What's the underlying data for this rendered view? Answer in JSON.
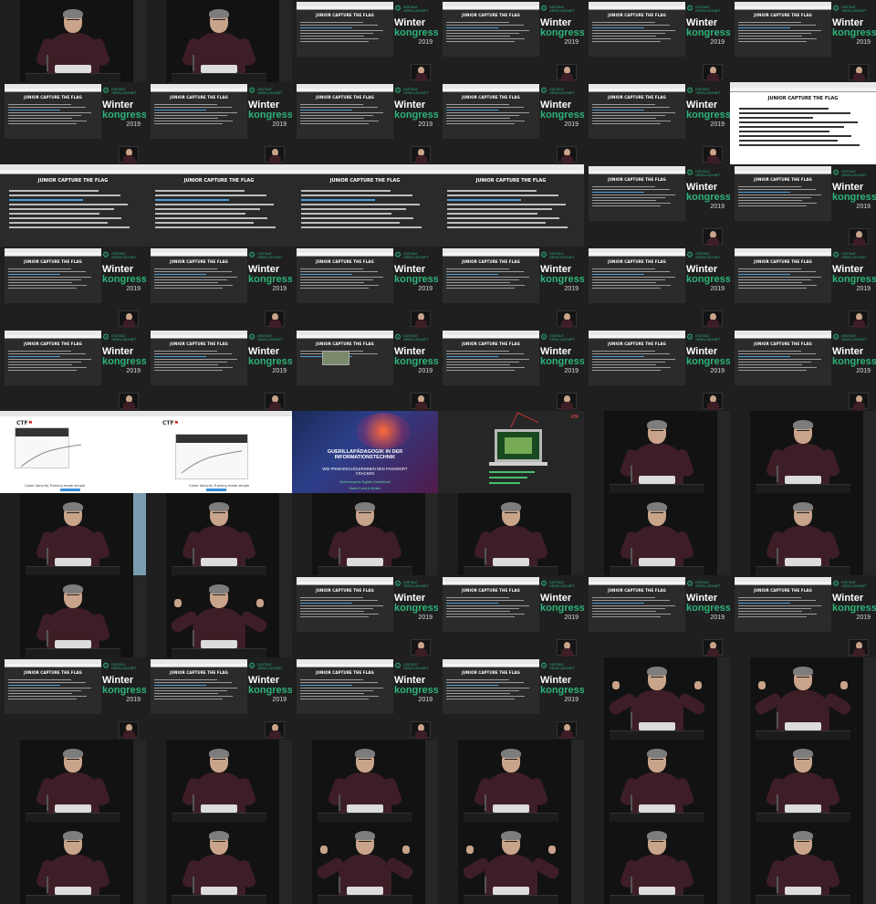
{
  "event": {
    "brand_line1": "DIGITALE",
    "brand_line2": "GESELLSCHAFT",
    "title_word1": "Winter",
    "title_word2": "kongress",
    "year": "2019"
  },
  "slides": {
    "ctf_heading": "JUNIOR CAPTURE THE FLAG",
    "ctf_logo_prefix": "CTF",
    "site_caption": "Cyber Security Training made simple",
    "promo_line1": "GUERILLAPÄDAGOGIK IN DER",
    "promo_line2": "INFORMATIONSTECHNIK",
    "promo_line3": "WIE PRIMARSCHÜLERINNEN DEN PASSWORT",
    "promo_line4": "CRACKEN",
    "promo_line5": "Winterkongress Digitale Gesellschaft",
    "promo_line6": "Basler Kunst & Medien",
    "laptop_tag": "CTF"
  },
  "layout_types": [
    [
      "speaker",
      "speaker",
      "slide",
      "slide",
      "slide",
      "slide",
      "slide",
      "slide",
      "slide",
      "slide",
      "slide",
      "full-white",
      "full",
      "full",
      "full",
      "full",
      "slide",
      "slide",
      "slide",
      "slide",
      "slide",
      "slide",
      "slide",
      "slide",
      "slide",
      "slide",
      "slide-vid",
      "slide",
      "slide",
      "slide",
      "site-sm",
      "site",
      "promo",
      "laptop",
      "speaker",
      "speaker",
      "speaker-bright",
      "speaker",
      "speaker",
      "speaker",
      "speaker",
      "speaker",
      "speaker",
      "speaker-gesture",
      "slide",
      "slide",
      "slide",
      "slide",
      "slide",
      "slide",
      "slide",
      "slide",
      "speaker-gesture",
      "speaker-gesture",
      "speaker",
      "speaker",
      "speaker",
      "speaker",
      "speaker",
      "speaker",
      "speaker",
      "speaker",
      "speaker-gesture",
      "speaker-gesture",
      "speaker",
      "speaker"
    ]
  ]
}
